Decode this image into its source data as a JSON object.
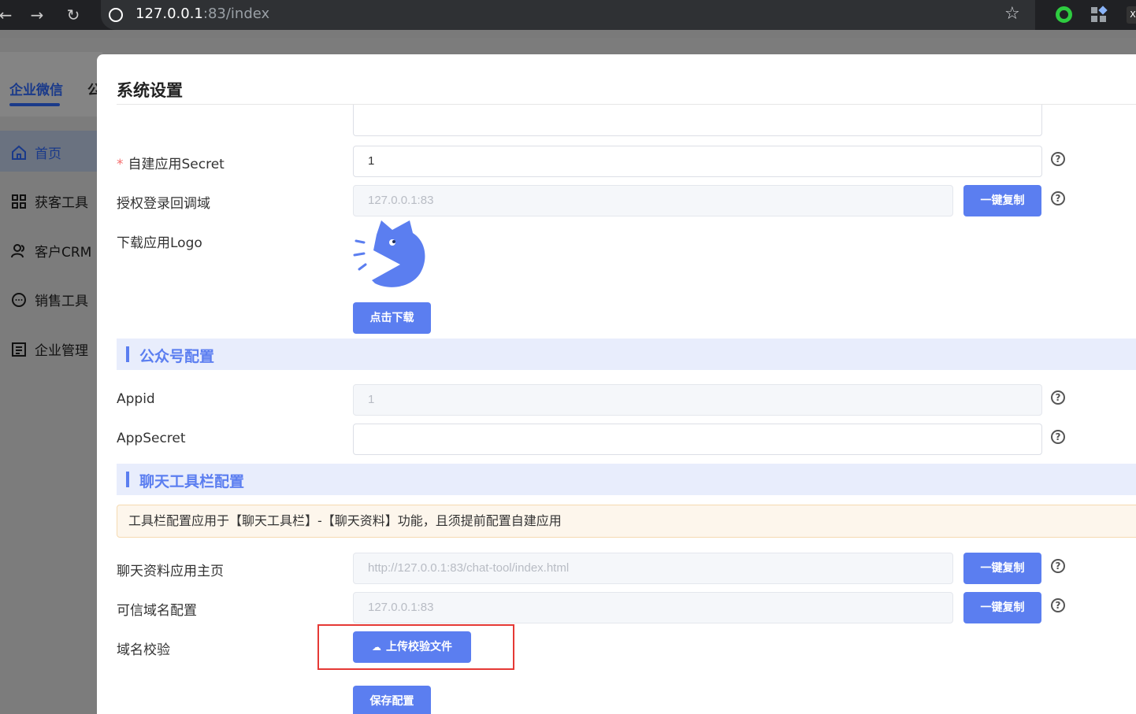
{
  "browser": {
    "url_host": "127.0.0.1",
    "url_rest": ":83/index",
    "back_icon": "arrow-left-icon",
    "forward_icon": "arrow-right-icon",
    "reload_icon": "reload-icon",
    "star_icon": "star-icon"
  },
  "topnav": {
    "active_tab": "企业微信",
    "other_tab": "公"
  },
  "sidebar": {
    "items": [
      {
        "label": "首页",
        "icon": "home-icon"
      },
      {
        "label": "获客工具",
        "icon": "grid-icon"
      },
      {
        "label": "客户CRM",
        "icon": "users-icon"
      },
      {
        "label": "销售工具",
        "icon": "chat-icon"
      },
      {
        "label": "企业管理",
        "icon": "building-icon"
      }
    ]
  },
  "dialog": {
    "title": "系统设置",
    "fields": {
      "secret_label": "自建应用Secret",
      "secret_value": "1",
      "callback_label": "授权登录回调域",
      "callback_value": "127.0.0.1:83",
      "logo_label": "下载应用Logo",
      "download_button": "点击下载"
    },
    "mp_section": {
      "title": "公众号配置",
      "appid_label": "Appid",
      "appid_value": "1",
      "appsecret_label": "AppSecret",
      "appsecret_value": ""
    },
    "toolbar_section": {
      "title": "聊天工具栏配置",
      "notice": "工具栏配置应用于【聊天工具栏】-【聊天资料】功能，且须提前配置自建应用",
      "home_label": "聊天资料应用主页",
      "home_value": "http://127.0.0.1:83/chat-tool/index.html",
      "domain_label": "可信域名配置",
      "domain_value": "127.0.0.1:83",
      "verify_label": "域名校验",
      "upload_button": "上传校验文件",
      "save_button": "保存配置"
    },
    "copy_button": "一键复制",
    "help_icon": "question-circle-icon"
  },
  "colors": {
    "primary": "#5b7ef0",
    "highlight_box": "#e53935",
    "required": "#f56c6c"
  }
}
